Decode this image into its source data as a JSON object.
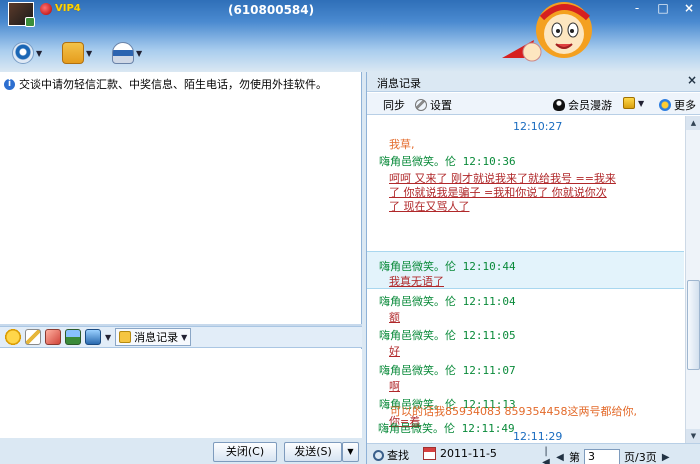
{
  "header": {
    "vip_label": "VIP4",
    "qq_number": "(610800584)",
    "window_controls": [
      "-",
      "□",
      "×"
    ]
  },
  "left": {
    "notice": "交谈中请勿轻信汇款、中奖信息、陌生电话，勿使用外挂软件。",
    "msg_record_label": "消息记录",
    "close_button": "关闭(C)",
    "send_button": "发送(S)"
  },
  "history_panel": {
    "title": "消息记录",
    "close": "×",
    "tools": {
      "sync": "同步",
      "settings": "设置",
      "roaming": "会员漫游",
      "more": "更多"
    },
    "entries": [
      {
        "type": "time",
        "text": "12:10:27"
      },
      {
        "type": "msg_orange",
        "text": "我草,"
      },
      {
        "type": "sender",
        "text": "嗨角邑微笑。伦 12:10:36"
      },
      {
        "type": "msg",
        "text": "呵呵    又来了    刚才就说我来了就给我号      ==我来"
      },
      {
        "type": "msg",
        "text": "了   你就说我是骗子    =我和你说了  你就说你次"
      },
      {
        "type": "msg",
        "text": "了    现在又骂人了"
      },
      {
        "type": "sender",
        "text": "嗨角邑微笑。伦 12:10:44"
      },
      {
        "type": "msg",
        "text": "我真无语了"
      },
      {
        "type": "sender",
        "text": "嗨角邑微笑。伦 12:11:04"
      },
      {
        "type": "msg",
        "text": "额"
      },
      {
        "type": "sender",
        "text": "嗨角邑微笑。伦 12:11:05"
      },
      {
        "type": "msg",
        "text": "好"
      },
      {
        "type": "sender",
        "text": "嗨角邑微笑。伦 12:11:07"
      },
      {
        "type": "msg",
        "text": "啊"
      },
      {
        "type": "sender",
        "text": "嗨角邑微笑。伦 12:11:13"
      },
      {
        "type": "msg",
        "text": "你=着"
      },
      {
        "type": "time",
        "text": "12:11:29"
      },
      {
        "type": "msg_orange",
        "text": "可以的话我85934083      859354458这两号都给你,"
      },
      {
        "type": "sender",
        "text": "嗨角邑微笑。伦 12:11:49"
      }
    ],
    "bottom": {
      "search": "查找",
      "date": "2011-11-5",
      "page_prefix": "第",
      "page_value": "3",
      "page_suffix": "页/3页"
    }
  }
}
